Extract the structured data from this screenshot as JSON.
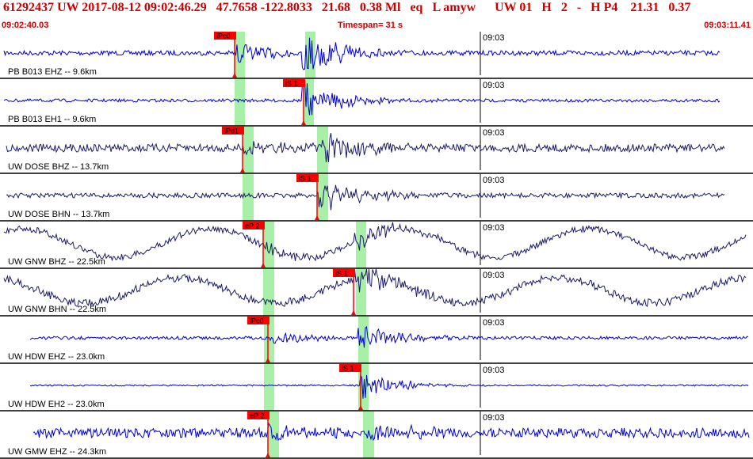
{
  "header": {
    "title": "61292437 UW 2017-08-12 09:02:46.29   47.7658 -122.8033   21.68   0.38 Ml   eq   L amyw      UW 01   H   2   -   H P4    21.31   0.37",
    "start_time": "09:02:40.03",
    "timespan": "Timespan=  31 s",
    "end_time": "09:03:11.41"
  },
  "colors": {
    "header_text": "#cc0000",
    "trace_blue": "#0000cc",
    "trace_dark": "#1a1a66",
    "pick_red": "#ff0000",
    "window_green": "#a8f0a8"
  },
  "traces": [
    {
      "station": "PB B013 EHZ -- 9.6km",
      "pick": "iPc0",
      "time_label": "09:03"
    },
    {
      "station": "PB B013 EH1 -- 9.6km",
      "pick": "iS 1",
      "time_label": "09:03"
    },
    {
      "station": "UW DOSE BHZ -- 13.7km",
      "pick": "iPd1",
      "time_label": "09:03"
    },
    {
      "station": "UW DOSE BHN -- 13.7km",
      "pick": "iS 1",
      "time_label": "09:03"
    },
    {
      "station": "UW GNW BHZ -- 22.5km",
      "pick": "eP 2",
      "time_label": "09:03"
    },
    {
      "station": "UW GNW BHN -- 22.5km",
      "pick": "iS 1",
      "time_label": "09:03"
    },
    {
      "station": "UW HDW EHZ -- 23.0km",
      "pick": "iPc0",
      "time_label": "09:03"
    },
    {
      "station": "UW HDW EH2 -- 23.0km",
      "pick": "iS 1",
      "time_label": "09:03"
    },
    {
      "station": "UW GMW EHZ -- 24.3km",
      "pick": "eP 2",
      "time_label": "09:03"
    }
  ]
}
